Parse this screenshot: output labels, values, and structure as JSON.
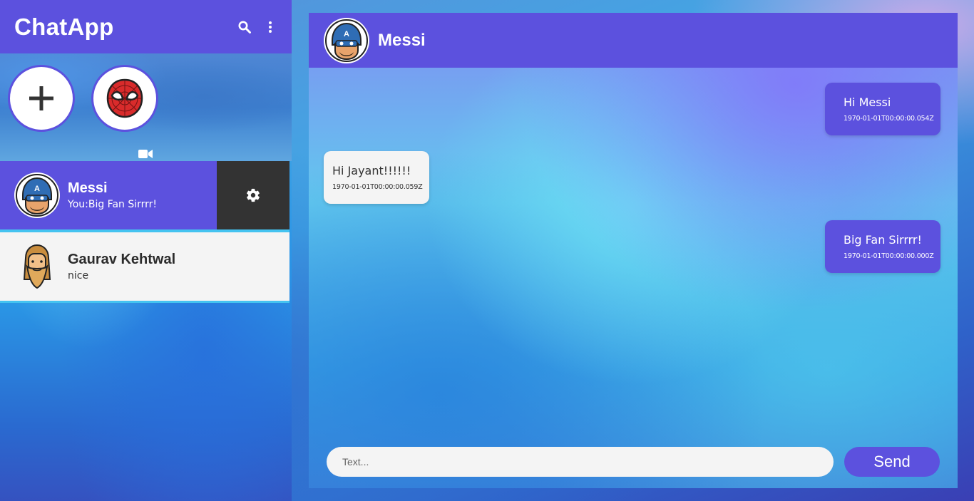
{
  "app": {
    "title": "ChatApp"
  },
  "header_icons": [
    "search-icon",
    "more-vert-icon"
  ],
  "stories": [
    {
      "type": "add",
      "icon": "plus-icon"
    },
    {
      "type": "contact",
      "icon": "spiderman-avatar"
    }
  ],
  "video_icon": "video-camera-icon",
  "chats": [
    {
      "name": "Messi",
      "preview": "You:Big Fan Sirrrr!",
      "avatar": "captain-america-avatar",
      "active": true,
      "action_icon": "gear-icon"
    },
    {
      "name": "Gaurav Kehtwal",
      "preview": "nice",
      "avatar": "bearded-man-avatar",
      "active": false
    }
  ],
  "conversation": {
    "contact_name": "Messi",
    "messages": [
      {
        "direction": "out",
        "text": "Hi Messi",
        "time": "1970-01-01T00:00:00.054Z"
      },
      {
        "direction": "in",
        "text": "Hi Jayant!!!!!!",
        "time": "1970-01-01T00:00:00.059Z"
      },
      {
        "direction": "out",
        "text": "Big Fan Sirrrr!",
        "time": "1970-01-01T00:00:00.000Z"
      }
    ]
  },
  "composer": {
    "placeholder": "Text...",
    "value": "",
    "send_label": "Send"
  },
  "colors": {
    "accent": "#5c51de",
    "dark": "#333333",
    "light": "#f4f4f4",
    "divider": "#44c3f0"
  }
}
